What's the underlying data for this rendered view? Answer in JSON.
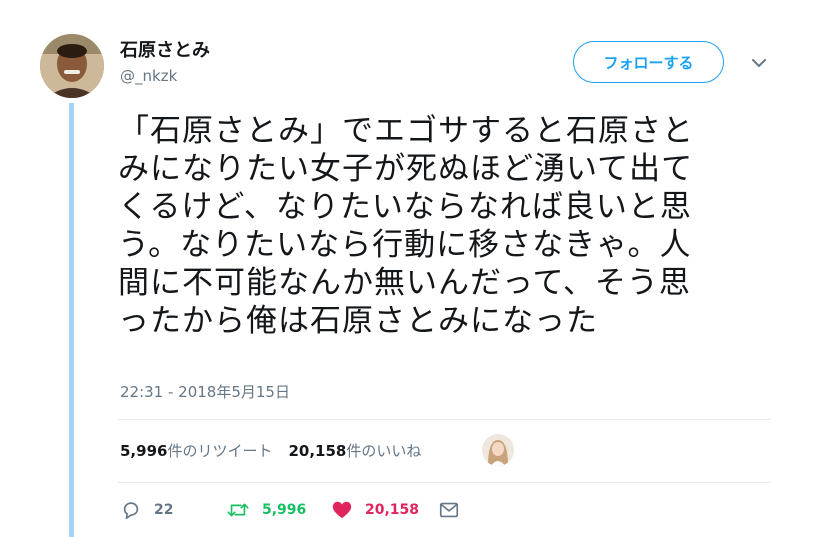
{
  "user": {
    "display_name": "石原さとみ",
    "handle": "@_nkzk"
  },
  "follow_button_label": "フォローする",
  "tweet": {
    "lines": [
      "「石原さとみ」でエゴサすると石原さと",
      "みになりたい女子が死ぬほど湧いて出て",
      "くるけど、なりたいならなれば良いと思",
      "う。なりたいなら行動に移さなきゃ。人",
      "間に不可能なんか無いんだって、そう思",
      "ったから俺は石原さとみになった"
    ],
    "timestamp": "22:31 - 2018年5月15日"
  },
  "stats": {
    "retweets_count": "5,996",
    "retweets_label": "件のリツイート",
    "likes_count": "20,158",
    "likes_label": "件のいいね"
  },
  "actions": {
    "reply_count": "22",
    "retweet_count": "5,996",
    "like_count": "20,158"
  },
  "icons": [
    "reply-icon",
    "retweet-icon",
    "heart-icon",
    "mail-icon",
    "chevron-down-icon"
  ],
  "colors": {
    "accent": "#1da1f2",
    "retweet": "#17bf63",
    "like": "#e0245e",
    "secondary_text": "#657786",
    "thread_line": "#a3d6f5"
  }
}
